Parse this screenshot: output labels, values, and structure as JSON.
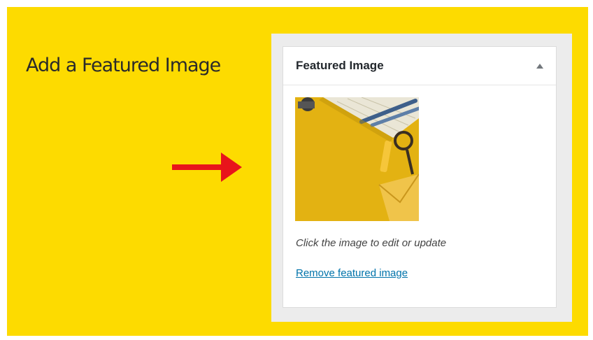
{
  "slide": {
    "headline": "Add a Featured Image",
    "arrow_color": "#e8141b",
    "background_color": "#fddb00"
  },
  "metabox": {
    "title": "Featured Image",
    "toggle_icon": "triangle-up-icon",
    "thumbnail_alt": "Featured image thumbnail",
    "hint": "Click the image to edit or update",
    "remove_link": "Remove featured image",
    "link_color": "#0073aa"
  }
}
